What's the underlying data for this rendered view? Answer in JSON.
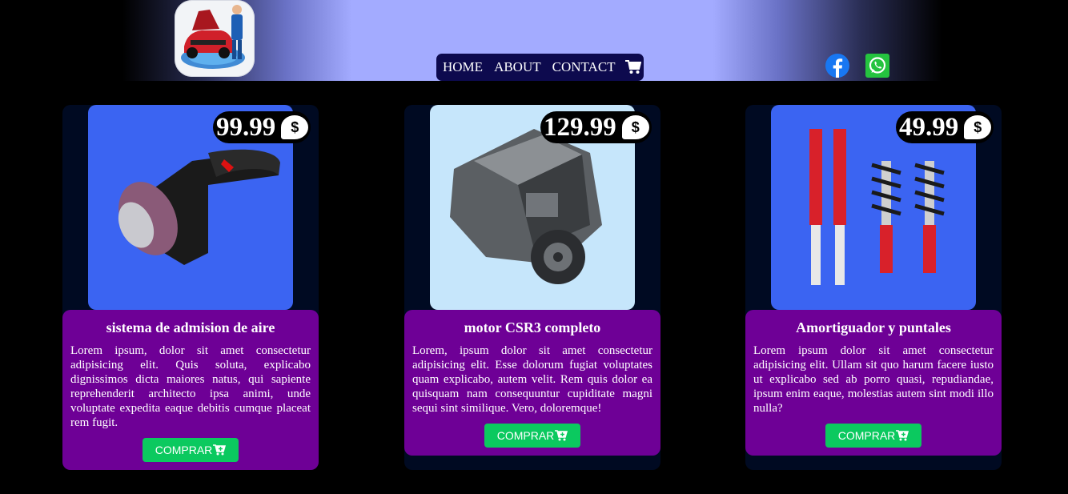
{
  "header": {
    "nav": [
      {
        "label": "HOME"
      },
      {
        "label": "ABOUT"
      },
      {
        "label": "CONTACT"
      }
    ],
    "cart_icon": "shopping-cart-icon",
    "social": [
      "facebook-icon",
      "whatsapp-icon"
    ]
  },
  "products": [
    {
      "price": "99.99",
      "currency_icon": "dollar-icon",
      "title": "sistema de admision de aire",
      "description": "Lorem ipsum, dolor sit amet consectetur adipisicing elit. Quis soluta, explicabo dignissimos dicta maiores natus, qui sapiente reprehenderit architecto ipsa animi, unde voluptate expedita eaque debitis cumque placeat rem fugit.",
      "button": "COMPRAR"
    },
    {
      "price": "129.99",
      "currency_icon": "dollar-icon",
      "title": "motor CSR3 completo",
      "description": "Lorem, ipsum dolor sit amet consectetur adipisicing elit. Esse dolorum fugiat voluptates quam explicabo, autem velit. Rem quis dolor ea quisquam nam consequuntur cupiditate magni sequi sint similique. Vero, doloremque!",
      "button": "COMPRAR"
    },
    {
      "price": "49.99",
      "currency_icon": "dollar-icon",
      "title": "Amortiguador y puntales",
      "description": "Lorem ipsum dolor sit amet consectetur adipisicing elit. Ullam sit quo harum facere iusto ut explicabo sed ab porro quasi, repudiandae, ipsum enim eaque, molestias autem sint modi illo nulla?",
      "button": "COMPRAR"
    }
  ],
  "colors": {
    "header_mid": "#a3abff",
    "nav_bg": "#0d0a4e",
    "card_body": "#6e0096",
    "button": "#0bc95f"
  }
}
